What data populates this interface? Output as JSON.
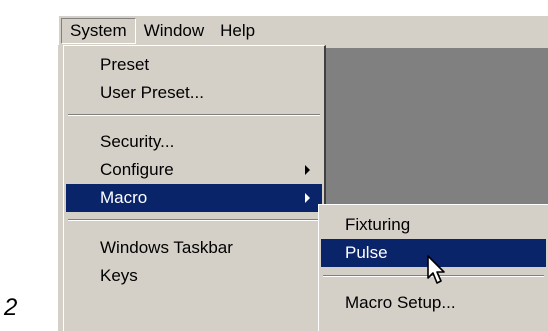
{
  "step_number": "2",
  "menubar": {
    "items": [
      {
        "label": "System",
        "active": true
      },
      {
        "label": "Window",
        "active": false
      },
      {
        "label": "Help",
        "active": false
      }
    ]
  },
  "system_menu": {
    "items": [
      {
        "label": "Preset"
      },
      {
        "label": "User Preset..."
      },
      {
        "label": "Security..."
      },
      {
        "label": "Configure",
        "has_submenu": true
      },
      {
        "label": "Macro",
        "has_submenu": true,
        "highlighted": true
      },
      {
        "label": "Windows Taskbar"
      },
      {
        "label": "Keys"
      }
    ]
  },
  "macro_submenu": {
    "items": [
      {
        "label": "Fixturing"
      },
      {
        "label": "Pulse",
        "highlighted": true
      },
      {
        "label": "Macro Setup..."
      }
    ]
  },
  "colors": {
    "menu_face": "#d4d0c8",
    "highlight": "#0a246a",
    "workspace": "#808080"
  },
  "cursor": {
    "icon": "arrow-pointer-icon"
  }
}
